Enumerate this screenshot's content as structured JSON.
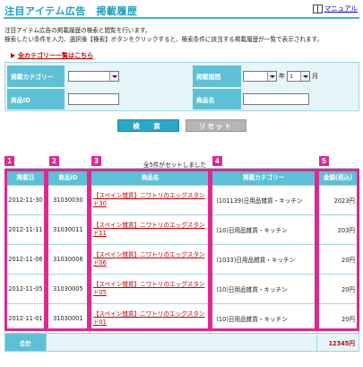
{
  "header": {
    "title": "注目アイテム広告　掲載履歴",
    "manual_label": "マニュアル"
  },
  "description": {
    "line1": "注目アイテム広告の掲載履歴の検索と閲覧を行います。",
    "line2": "検索したい条件を入力、選択後【検索】ボタンをクリックすると、検索条件に該当する掲載履歴が一覧で表示されます。"
  },
  "all_categories_link": "全カテゴリー一覧はこちら",
  "search": {
    "category_label": "掲載カテゴリー",
    "period_label": "掲載期間",
    "year_unit": "年",
    "month_value": "1",
    "month_unit": "月",
    "product_id_label": "商品ID",
    "product_name_label": "商品名",
    "search_button": "検　索",
    "reset_button": "リセット"
  },
  "result_count": "全5件がセットしました",
  "table": {
    "headers": [
      "掲載日",
      "商品ID",
      "商品名",
      "掲載カテゴリー",
      "金額(税込)"
    ],
    "rows": [
      {
        "date": "2012-11-30",
        "id": "31030030",
        "name1": "【スペイン雑貨】ニワトリのエッグスタン",
        "name2": "ド30",
        "category": "(101139)日用品雑貨・キッチン",
        "price": "2023円"
      },
      {
        "date": "2012-11-11",
        "id": "31030011",
        "name1": "【スペイン雑貨】ニワトリのエッグスタン",
        "name2": "ド11",
        "category": "(10)日用品雑貨・キッチン",
        "price": "203円"
      },
      {
        "date": "2012-11-06",
        "id": "31030006",
        "name1": "【スペイン雑貨】ニワトリのエッグスタン",
        "name2": "ド06",
        "category": "(1033)日用品雑貨・キッチン",
        "price": "20円"
      },
      {
        "date": "2012-11-05",
        "id": "31030005",
        "name1": "【スペイン雑貨】ニワトリのエッグスタン",
        "name2": "ド05",
        "category": "(10)日用品雑貨・キッチン",
        "price": "20円"
      },
      {
        "date": "2012-11-01",
        "id": "31030001",
        "name1": "【スペイン雑貨】ニワトリのエッグスタン",
        "name2": "ド01",
        "category": "(10)日用品雑貨・キッチン",
        "price": "20円"
      }
    ],
    "total_label": "合計",
    "total_value": "12345円"
  },
  "annotations": [
    "1",
    "2",
    "3",
    "4",
    "5"
  ],
  "colors": {
    "accent": "#1aa0bf",
    "header_bg": "#5dc0d6",
    "highlight": "#e0288f",
    "link_red": "#cc0000"
  }
}
